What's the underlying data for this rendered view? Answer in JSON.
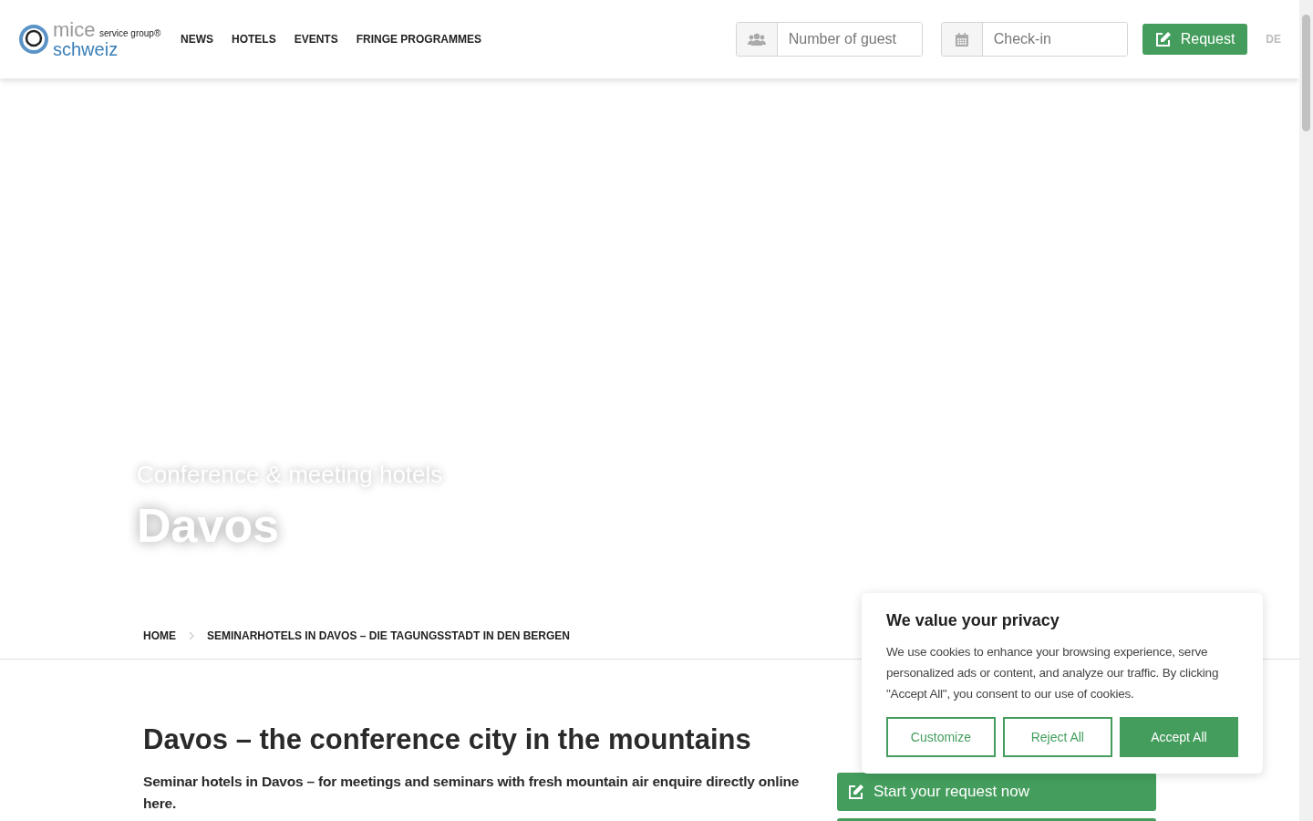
{
  "header": {
    "logo": {
      "word_1": "mice",
      "word_2": "service group",
      "mark": "®",
      "word_3": "schweiz"
    },
    "nav": [
      "NEWS",
      "HOTELS",
      "EVENTS",
      "FRINGE PROGRAMMES"
    ],
    "fields": [
      {
        "kind": "guests",
        "placeholder": "Number of guest"
      },
      {
        "kind": "date",
        "placeholder": "Check-in"
      }
    ],
    "request_button": "Request",
    "language": "DE"
  },
  "hero": {
    "kicker": "Conference & meeting hotels",
    "title": "Davos"
  },
  "breadcrumb": [
    "HOME",
    "SEMINARHOTELS IN DAVOS – DIE TAGUNGSSTADT IN DEN BERGEN"
  ],
  "content": {
    "title": "Davos – the conference city in the mountains",
    "lead": "Seminar hotels in Davos – for meetings and seminars with fresh mountain air enquire directly online here.",
    "start_button": "Start your request now"
  },
  "cookie_banner": {
    "title": "We value your privacy",
    "text": "We use cookies to enhance your browsing experience, serve personalized ads or content, and analyze our traffic. By clicking \"Accept All\", you consent to our use of cookies.",
    "buttons": [
      {
        "label": "Customize",
        "kind": "outline"
      },
      {
        "label": "Reject All",
        "kind": "outline"
      },
      {
        "label": "Accept All",
        "kind": "solid"
      }
    ]
  }
}
